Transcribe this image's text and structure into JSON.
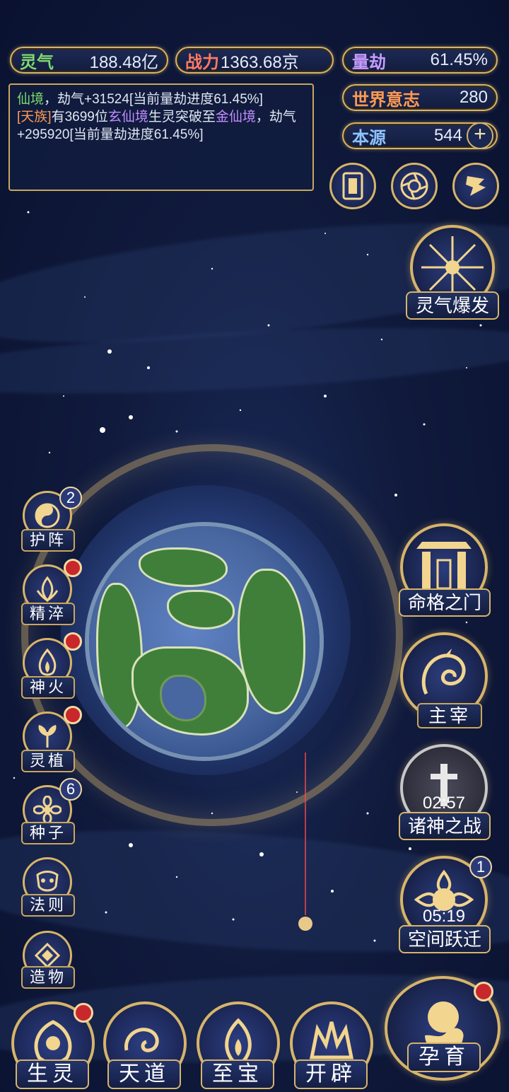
{
  "stats": {
    "lingqi": {
      "label": "灵气",
      "value": "188.48亿"
    },
    "zhanli": {
      "label": "战力",
      "value": "1363.68京"
    },
    "liangjie": {
      "label": "量劫",
      "value": "61.45%"
    },
    "shijie": {
      "label": "世界意志",
      "value": "280"
    },
    "benyuan": {
      "label": "本源",
      "value": "544",
      "plus": "+"
    }
  },
  "log": {
    "line1_tag": "仙境",
    "line1_text": "，劫气+31524[当前量劫进度61.45%]",
    "line2_tag": "[天族]",
    "line2_text_a": "有3699位",
    "line2_realm_a": "玄仙境",
    "line2_text_b": "生灵突破至",
    "line2_realm_b": "金仙境",
    "line2_text_c": "，劫气+295920[当前量劫进度61.45%]"
  },
  "right_panel": {
    "burst_label": "灵气爆发",
    "fate_label": "命格之门",
    "ruler_label": "主宰",
    "war_label": "诸神之战",
    "war_timer": "02:57",
    "leap_label": "空间跃迁",
    "leap_timer": "05:19",
    "leap_badge": "1",
    "breed_label": "孕育"
  },
  "left_panel": {
    "items": [
      {
        "label": "护阵",
        "badge": "2"
      },
      {
        "label": "精淬"
      },
      {
        "label": "神火"
      },
      {
        "label": "灵植"
      },
      {
        "label": "种子",
        "badge": "6"
      },
      {
        "label": "法则"
      },
      {
        "label": "造物"
      }
    ]
  },
  "bottom_bar": {
    "items": [
      {
        "label": "生灵"
      },
      {
        "label": "天道"
      },
      {
        "label": "至宝"
      },
      {
        "label": "开辟"
      }
    ]
  },
  "colors": {
    "gold": "#d6b46a",
    "panel_bg": "#141d40",
    "alert": "#c8282c",
    "sky": "#101a3c"
  }
}
